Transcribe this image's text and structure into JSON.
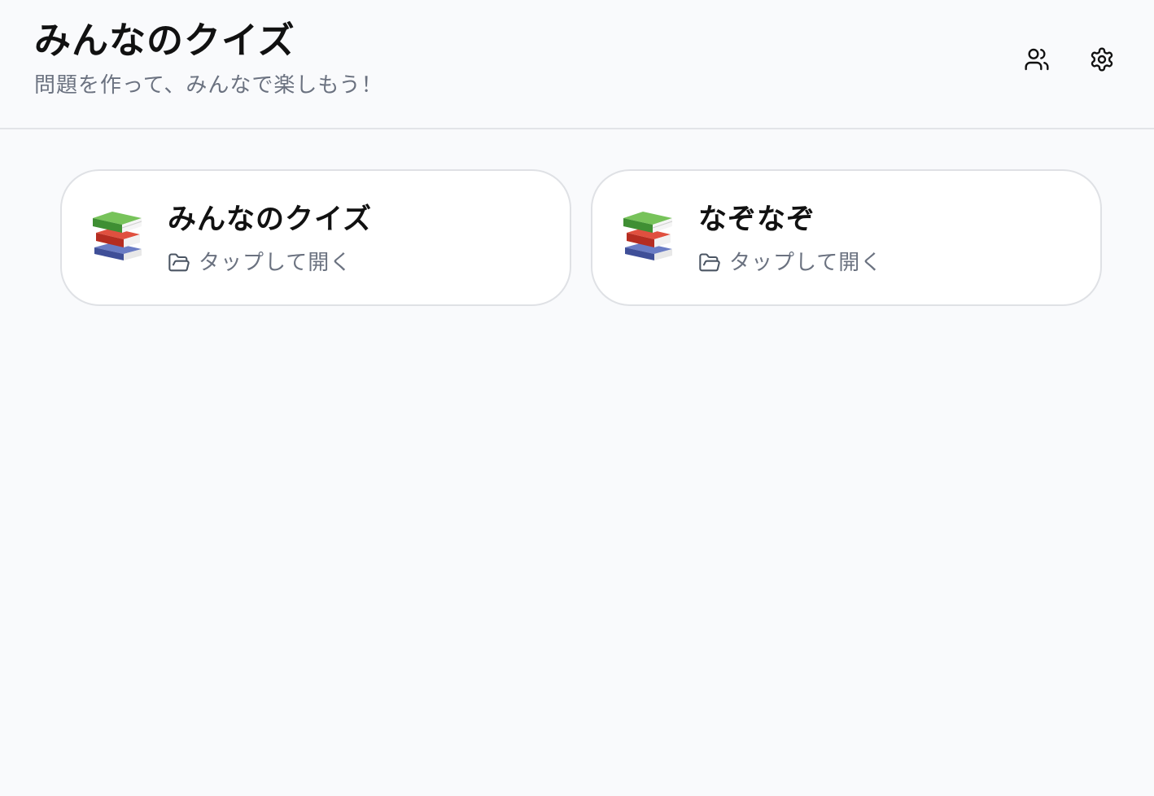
{
  "header": {
    "title": "みんなのクイズ",
    "subtitle": "問題を作って、みんなで楽しもう！",
    "actions": [
      {
        "icon": "users-icon",
        "label": ""
      },
      {
        "icon": "gear-icon",
        "label": ""
      }
    ]
  },
  "cards": [
    {
      "icon": "books-icon",
      "title": "みんなのクイズ",
      "action_label": "タップして開く",
      "action_icon": "folder-open-icon"
    },
    {
      "icon": "books-icon",
      "title": "なぞなぞ",
      "action_label": "タップして開く",
      "action_icon": "folder-open-icon"
    }
  ],
  "colors": {
    "background": "#f9fafc",
    "card": "#ffffff",
    "border": "#dfe1e5",
    "text": "#111111",
    "muted": "#6b7280",
    "book_green": "#5fb249",
    "book_red": "#d33a2c",
    "book_blue": "#4a5ca8"
  }
}
